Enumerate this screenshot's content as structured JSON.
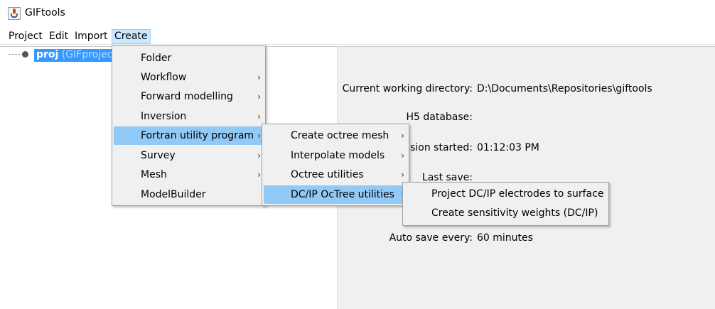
{
  "window": {
    "title": "GIFtools"
  },
  "menubar": {
    "items": [
      "Project",
      "Edit",
      "Import",
      "Create"
    ]
  },
  "tree": {
    "root_name": "proj",
    "root_type": "(GIFproject)"
  },
  "info": {
    "cwd_label": "Current working directory:",
    "cwd_value": "D:\\Documents\\Repositories\\giftools",
    "h5_label": "H5 database:",
    "h5_value": "",
    "session_label": "Session started:",
    "session_value": "01:12:03 PM",
    "lastsave_label": "Last save:",
    "lastsave_value": "",
    "autosave_label": "Auto save every:",
    "autosave_value": "60 minutes"
  },
  "create_menu": {
    "items": [
      {
        "label": "Folder",
        "submenu": false,
        "selected": false
      },
      {
        "label": "Workflow",
        "submenu": true,
        "selected": false
      },
      {
        "label": "Forward modelling",
        "submenu": true,
        "selected": false
      },
      {
        "label": "Inversion",
        "submenu": true,
        "selected": false
      },
      {
        "label": "Fortran utility program",
        "submenu": true,
        "selected": true
      },
      {
        "label": "Survey",
        "submenu": true,
        "selected": false
      },
      {
        "label": "Mesh",
        "submenu": true,
        "selected": false
      },
      {
        "label": "ModelBuilder",
        "submenu": false,
        "selected": false
      }
    ]
  },
  "fortran_menu": {
    "items": [
      {
        "label": "Create octree mesh",
        "submenu": true,
        "selected": false
      },
      {
        "label": "Interpolate models",
        "submenu": true,
        "selected": false
      },
      {
        "label": "Octree utilities",
        "submenu": true,
        "selected": false
      },
      {
        "label": "DC/IP OcTree utilities",
        "submenu": true,
        "selected": true
      }
    ]
  },
  "dcip_menu": {
    "items": [
      {
        "label": "Project DC/IP electrodes to surface",
        "submenu": false,
        "selected": false
      },
      {
        "label": "Create sensitivity weights (DC/IP)",
        "submenu": false,
        "selected": false
      }
    ]
  },
  "icons": {
    "app": "java-cup-icon",
    "submenu_arrow": "chevron-right-icon",
    "tree_node": "tree-node-icon"
  },
  "colors": {
    "selection": "#3399ff",
    "menu_highlight": "#91c9f7",
    "menubar_active": "#cce8ff"
  }
}
